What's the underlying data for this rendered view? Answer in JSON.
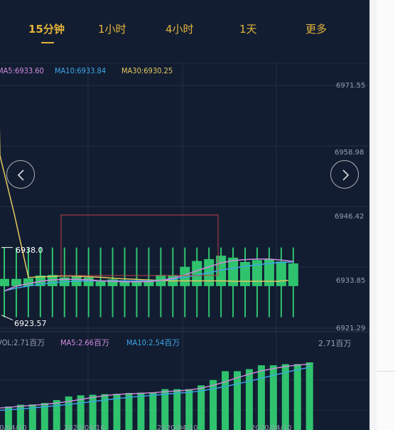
{
  "tabs": [
    {
      "label": "15分钟",
      "active": true
    },
    {
      "label": "1小时",
      "active": false
    },
    {
      "label": "4小时",
      "active": false
    },
    {
      "label": "1天",
      "active": false
    },
    {
      "label": "更多",
      "active": false
    }
  ],
  "price_legend": {
    "ma5": "MA5:6933.60",
    "ma10": "MA10:6933.84",
    "ma30": "MA30:6930.25"
  },
  "price_axis": [
    "6971.55",
    "6958.98",
    "6946.42",
    "6933.85",
    "6921.29"
  ],
  "high_label": "6938.0",
  "low_label": "6923.57",
  "volume_legend": {
    "vol": "VOL:2.71百万",
    "ma5": "MA5:2.66百万",
    "ma10": "MA10:2.54百万"
  },
  "volume_axis_max": "2.71百万",
  "date_labels": [
    "2020/04/10",
    "2020/04/10",
    "2020/04/10",
    "2020/04/10"
  ],
  "icons": {
    "prev": "chevron-left-icon",
    "next": "chevron-right-icon"
  },
  "colors": {
    "background": "#121d31",
    "accent": "#e3b33a",
    "up": "#2fc36e",
    "ma5": "#d38be0",
    "ma10": "#3ea6e8",
    "ma30": "#e3c860",
    "grid": "#243046"
  },
  "chart_data": {
    "type": "candlestick",
    "price_range": [
      6921.29,
      6971.55
    ],
    "candles": [
      {
        "open": 6930.0,
        "close": 6931.5,
        "high": 6938.0,
        "low": 6923.57
      },
      {
        "open": 6930.0,
        "close": 6931.5,
        "high": 6938.0,
        "low": 6923.57
      },
      {
        "open": 6930.0,
        "close": 6931.6,
        "high": 6938.0,
        "low": 6923.57
      },
      {
        "open": 6930.0,
        "close": 6932.2,
        "high": 6938.0,
        "low": 6923.57
      },
      {
        "open": 6930.0,
        "close": 6932.3,
        "high": 6938.0,
        "low": 6923.57
      },
      {
        "open": 6930.0,
        "close": 6931.8,
        "high": 6938.0,
        "low": 6923.57
      },
      {
        "open": 6930.0,
        "close": 6932.1,
        "high": 6938.0,
        "low": 6923.57
      },
      {
        "open": 6930.0,
        "close": 6931.8,
        "high": 6938.0,
        "low": 6923.57
      },
      {
        "open": 6930.0,
        "close": 6931.0,
        "high": 6938.0,
        "low": 6923.57
      },
      {
        "open": 6930.0,
        "close": 6931.4,
        "high": 6938.0,
        "low": 6923.57
      },
      {
        "open": 6930.0,
        "close": 6931.2,
        "high": 6938.0,
        "low": 6923.57
      },
      {
        "open": 6930.0,
        "close": 6931.2,
        "high": 6938.0,
        "low": 6923.57
      },
      {
        "open": 6930.0,
        "close": 6931.0,
        "high": 6938.0,
        "low": 6923.57
      },
      {
        "open": 6930.0,
        "close": 6932.3,
        "high": 6938.0,
        "low": 6923.57
      },
      {
        "open": 6930.0,
        "close": 6932.3,
        "high": 6938.0,
        "low": 6923.57
      },
      {
        "open": 6930.0,
        "close": 6934.0,
        "high": 6938.0,
        "low": 6923.57
      },
      {
        "open": 6930.0,
        "close": 6935.2,
        "high": 6938.0,
        "low": 6923.57
      },
      {
        "open": 6930.0,
        "close": 6935.6,
        "high": 6938.0,
        "low": 6923.57
      },
      {
        "open": 6930.0,
        "close": 6936.3,
        "high": 6938.0,
        "low": 6923.57
      },
      {
        "open": 6930.0,
        "close": 6935.9,
        "high": 6938.0,
        "low": 6923.57
      },
      {
        "open": 6930.0,
        "close": 6935.0,
        "high": 6938.0,
        "low": 6923.57
      },
      {
        "open": 6930.0,
        "close": 6935.4,
        "high": 6938.0,
        "low": 6923.57
      },
      {
        "open": 6930.0,
        "close": 6935.6,
        "high": 6938.0,
        "low": 6923.57
      },
      {
        "open": 6930.0,
        "close": 6935.1,
        "high": 6938.0,
        "low": 6923.57
      },
      {
        "open": 6930.0,
        "close": 6934.7,
        "high": 6938.0,
        "low": 6923.57
      }
    ],
    "ma5": [
      6929.0,
      6930.0,
      6930.5,
      6931.0,
      6931.3,
      6931.4,
      6931.4,
      6931.3,
      6931.1,
      6931.0,
      6930.9,
      6930.9,
      6930.9,
      6931.2,
      6931.6,
      6932.3,
      6933.2,
      6934.0,
      6934.8,
      6935.3,
      6935.5,
      6935.6,
      6935.6,
      6935.4,
      6935.1
    ],
    "ma10": [
      6929.0,
      6929.6,
      6930.0,
      6930.4,
      6930.7,
      6930.9,
      6931.0,
      6931.1,
      6931.1,
      6931.1,
      6931.1,
      6931.1,
      6931.1,
      6931.2,
      6931.4,
      6931.8,
      6932.3,
      6932.8,
      6933.3,
      6933.7,
      6934.1,
      6934.4,
      6934.7,
      6934.9,
      6935.0
    ],
    "ma30_prefix": [
      6957.0,
      6945.0
    ],
    "ma30": [
      6931.8,
      6931.9,
      6932.0,
      6932.1,
      6932.1,
      6932.0,
      6931.9,
      6931.8,
      6931.6,
      6931.5,
      6931.4,
      6931.3,
      6931.2,
      6931.1,
      6931.1,
      6931.1,
      6931.1,
      6931.1,
      6931.1,
      6931.0,
      6931.0,
      6931.0,
      6931.0,
      6931.0,
      6931.2
    ],
    "volume": [
      0.45,
      0.46,
      0.52,
      0.53,
      0.58,
      0.68,
      0.8,
      0.84,
      0.86,
      0.88,
      0.89,
      0.92,
      0.93,
      0.94,
      1.05,
      1.05,
      1.05,
      1.18,
      1.36,
      1.66,
      1.66,
      1.73,
      1.86,
      1.86,
      1.9,
      1.9,
      1.96
    ],
    "volume_ma5": [
      0.4,
      0.43,
      0.47,
      0.5,
      0.53,
      0.58,
      0.63,
      0.7,
      0.77,
      0.83,
      0.87,
      0.89,
      0.91,
      0.93,
      0.96,
      0.99,
      1.02,
      1.08,
      1.18,
      1.3,
      1.44,
      1.56,
      1.67,
      1.75,
      1.82,
      1.87,
      1.9
    ],
    "volume_ma10": [
      0.32,
      0.35,
      0.38,
      0.41,
      0.45,
      0.49,
      0.53,
      0.58,
      0.63,
      0.68,
      0.73,
      0.77,
      0.81,
      0.84,
      0.88,
      0.91,
      0.94,
      0.99,
      1.06,
      1.14,
      1.23,
      1.32,
      1.42,
      1.52,
      1.62,
      1.71,
      1.79
    ],
    "volume_max": 2.71
  }
}
